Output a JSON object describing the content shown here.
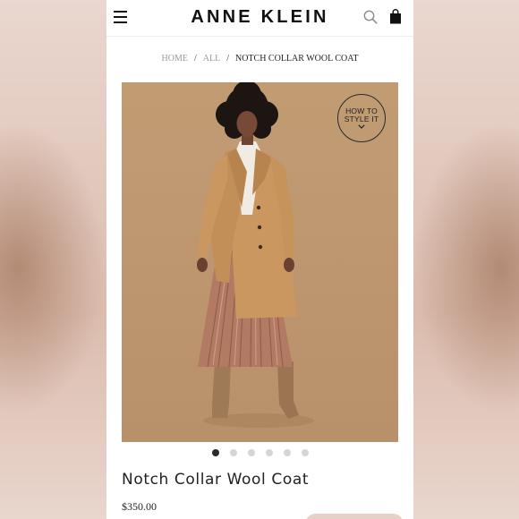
{
  "header": {
    "brand": "ANNE KLEIN",
    "menu_icon": "hamburger-menu-icon",
    "search_icon": "search-icon",
    "bag_icon": "shopping-bag-icon"
  },
  "breadcrumb": {
    "items": [
      "HOME",
      "ALL",
      "NOTCH COLLAR WOOL COAT"
    ],
    "separator": "/"
  },
  "gallery": {
    "badge_label": "HOW TO\nSTYLE IT",
    "badge_icon": "chevron-down-icon",
    "slide_count": 6,
    "active_slide": 1
  },
  "product": {
    "title": "Notch Collar Wool Coat",
    "price": "$350.00"
  },
  "colors": {
    "background": "#ffffff",
    "text": "#222222",
    "muted": "#9a9a9a",
    "photo_backdrop": "#bd9670",
    "dot_active": "#2b2b2b",
    "dot_inactive": "#d6d6d6"
  }
}
